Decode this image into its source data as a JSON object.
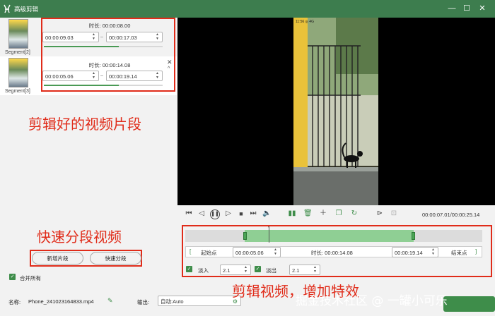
{
  "window": {
    "title": "高级剪辑",
    "minimize_icon": "minimize-icon",
    "maximize_icon": "maximize-icon",
    "close_icon": "close-icon"
  },
  "segments": [
    {
      "label": "Segment[2]",
      "duration": "时长:  00:00:08.00",
      "start": "00:00:09.03",
      "end": "00:00:17.03",
      "progress": 0.63
    },
    {
      "label": "Segment[3]",
      "duration": "时长:  00:00:14.08",
      "start": "00:00:05.06",
      "end": "00:00:19.14",
      "progress": 0.63
    }
  ],
  "annotations": {
    "clips": "剪辑好的视频片段",
    "split": "快速分段视频",
    "edit": "剪辑视频，增加特效"
  },
  "buttons": {
    "add_segment": "新增片段",
    "quick_split": "快速分段"
  },
  "merge_all": {
    "label": "合并所有",
    "checked": true
  },
  "player": {
    "time": "00:00:07.01/00:00:25.14"
  },
  "trim": {
    "start_label": "起始点",
    "start_value": "00:00:05.06",
    "duration_label": "时长:  00:00:14.08",
    "end_value": "00:00:19.14",
    "end_label": "结束点",
    "bracket_left": "[",
    "bracket_right": "]",
    "selection_start_fraction": 0.2,
    "selection_end_fraction": 0.77,
    "playhead_fraction": 0.28
  },
  "effects": {
    "fade_in_label": "淡入",
    "fade_in_value": "2.1",
    "fade_out_label": "淡出",
    "fade_out_value": "2.1"
  },
  "bottom": {
    "name_label": "名称:",
    "name_value": "Phone_241023164833.mp4",
    "output_label": "输出:",
    "output_value": "自动:Auto"
  },
  "watermark": "掘金技术社区 @ 一罐小可乐",
  "phone_status": "11:56 ◎ 4G",
  "colors": {
    "accent": "#3e8d4a",
    "annotation": "#e02c1a",
    "titlebar": "#3d7d4e"
  }
}
